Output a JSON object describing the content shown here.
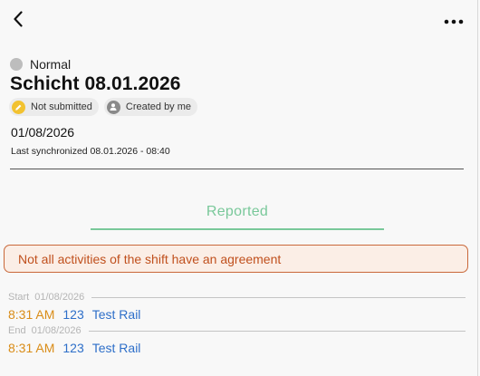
{
  "header": {
    "back_icon": "chevron-left-icon",
    "more_icon": "more-horizontal-icon"
  },
  "status": {
    "label": "Normal",
    "color": "#bdbdbd"
  },
  "title": "Schicht 08.01.2026",
  "badges": [
    {
      "label": "Not submitted",
      "icon": "pencil-icon",
      "color": "#f2c230"
    },
    {
      "label": "Created by me",
      "icon": "user-icon",
      "color": "#8a8a8a"
    }
  ],
  "date": "01/08/2026",
  "sync_text": "Last synchronized 08.01.2026 - 08:40",
  "tab": {
    "label": "Reported",
    "color": "#79c89a"
  },
  "alert": {
    "text": "Not all activities of the shift have an agreement",
    "color": "#c0501d"
  },
  "entries": [
    {
      "label": "Start",
      "date": "01/08/2026",
      "time": "8:31 AM",
      "number": "123",
      "name": "Test Rail"
    },
    {
      "label": "End",
      "date": "01/08/2026",
      "time": "8:31 AM",
      "number": "123",
      "name": "Test Rail"
    }
  ]
}
